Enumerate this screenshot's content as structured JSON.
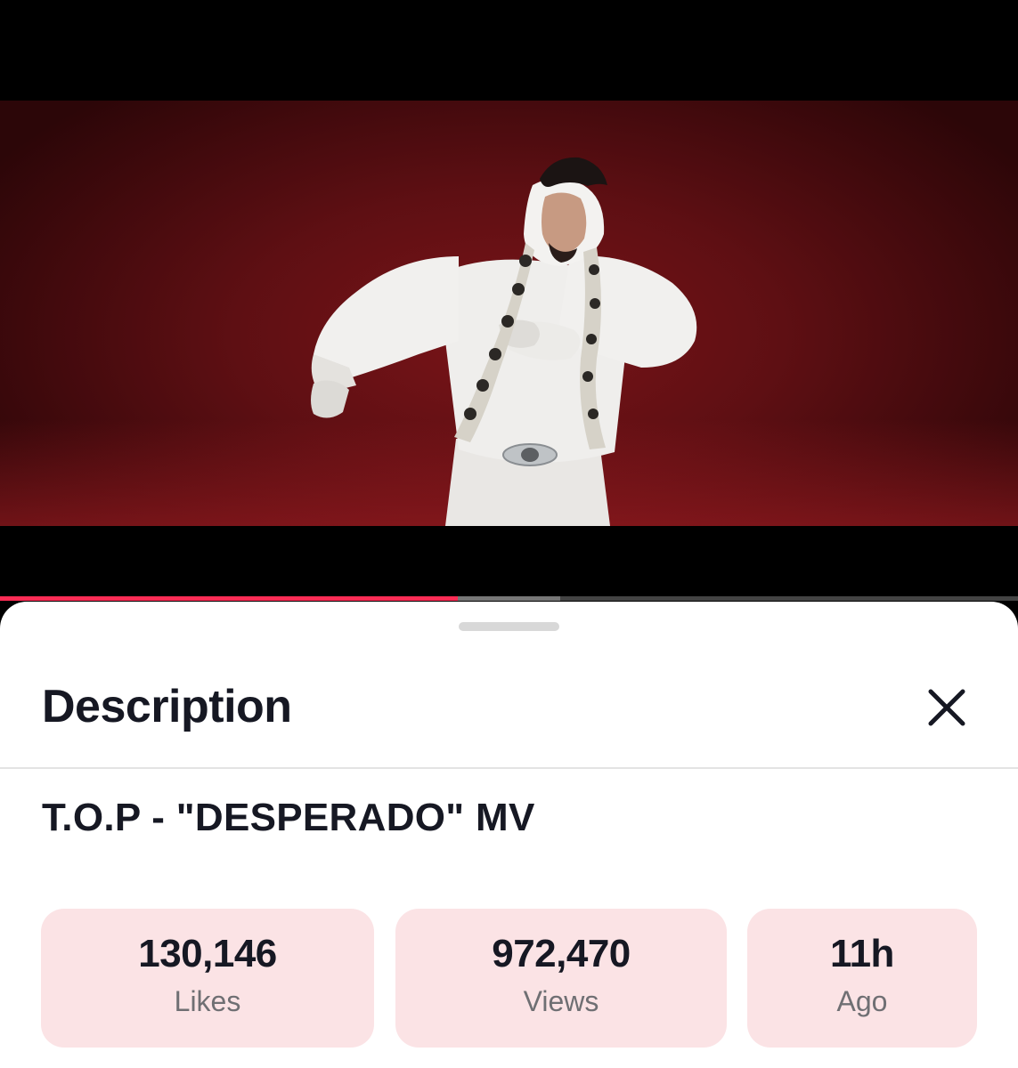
{
  "player": {
    "progress_played": 0.45,
    "progress_buffered": 0.55,
    "accent_color": "#fe2c55"
  },
  "sheet": {
    "title": "Description",
    "close_icon": "close-icon"
  },
  "video": {
    "title": "T.O.P - \"DESPERADO\" MV"
  },
  "stats": [
    {
      "value": "130,146",
      "label": "Likes"
    },
    {
      "value": "972,470",
      "label": "Views"
    },
    {
      "value": "11h",
      "label": "Ago"
    }
  ],
  "colors": {
    "stat_card_bg": "#fbe3e5",
    "video_bg": "#5e0f13"
  }
}
